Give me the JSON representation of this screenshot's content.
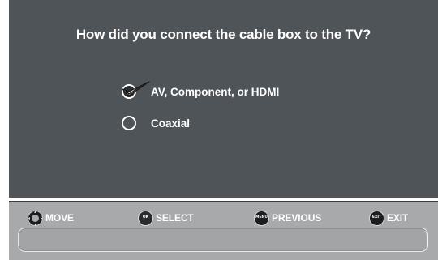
{
  "dialog": {
    "question": "How did you connect the cable box to the TV?",
    "options": [
      {
        "label": "AV, Component, or HDMI",
        "selected": true
      },
      {
        "label": "Coaxial",
        "selected": false
      }
    ]
  },
  "nav": {
    "move_label": "MOVE",
    "select_label": "SELECT",
    "select_icon_text": "OK",
    "previous_label": "PREVIOUS",
    "previous_icon_text": "MENU",
    "exit_label": "EXIT",
    "exit_icon_text": "EXIT"
  },
  "colors": {
    "panel": "#4f5459",
    "nav_bar": "#a7a9ab",
    "text": "#ffffff"
  },
  "icons": {
    "move": "dpad-icon",
    "select": "ok-button-icon",
    "previous": "menu-button-icon",
    "exit": "exit-button-icon",
    "selected_option": "checkmark-icon"
  }
}
